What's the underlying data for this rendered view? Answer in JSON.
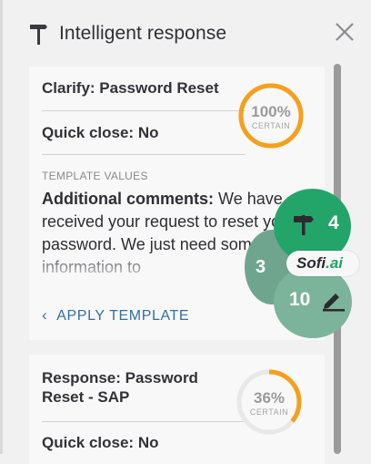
{
  "header": {
    "title": "Intelligent response",
    "icon": "signpost-icon",
    "close_icon": "close-icon"
  },
  "cards": [
    {
      "title": "Clarify: Password Reset",
      "quick_close": "Quick close: No",
      "confidence_pct": "100%",
      "confidence_label": "CERTAIN",
      "confidence_value": 1.0,
      "template_values_label": "TEMPLATE VALUES",
      "field_name": "Additional comments:",
      "field_text": "We have received your request to reset your password. We just need some more information to",
      "apply_label": "APPLY TEMPLATE"
    },
    {
      "title": "Response: Password Reset - SAP",
      "quick_close": "Quick close: No",
      "confidence_pct": "36%",
      "confidence_label": "CERTAIN",
      "confidence_value": 0.36
    }
  ],
  "widget": {
    "brand_sofi": "Sofi",
    "brand_ai": ".ai",
    "count_suggestions": "3",
    "count_responses": "4",
    "count_edits": "10"
  },
  "colors": {
    "gauge": "#f5a01c",
    "gauge_track": "#e8e8e8",
    "accent_link": "#336fa6",
    "bubble_dark": "#23a56a",
    "bubble_mid": "#6fa58e",
    "bubble_light": "#7cb49b"
  }
}
